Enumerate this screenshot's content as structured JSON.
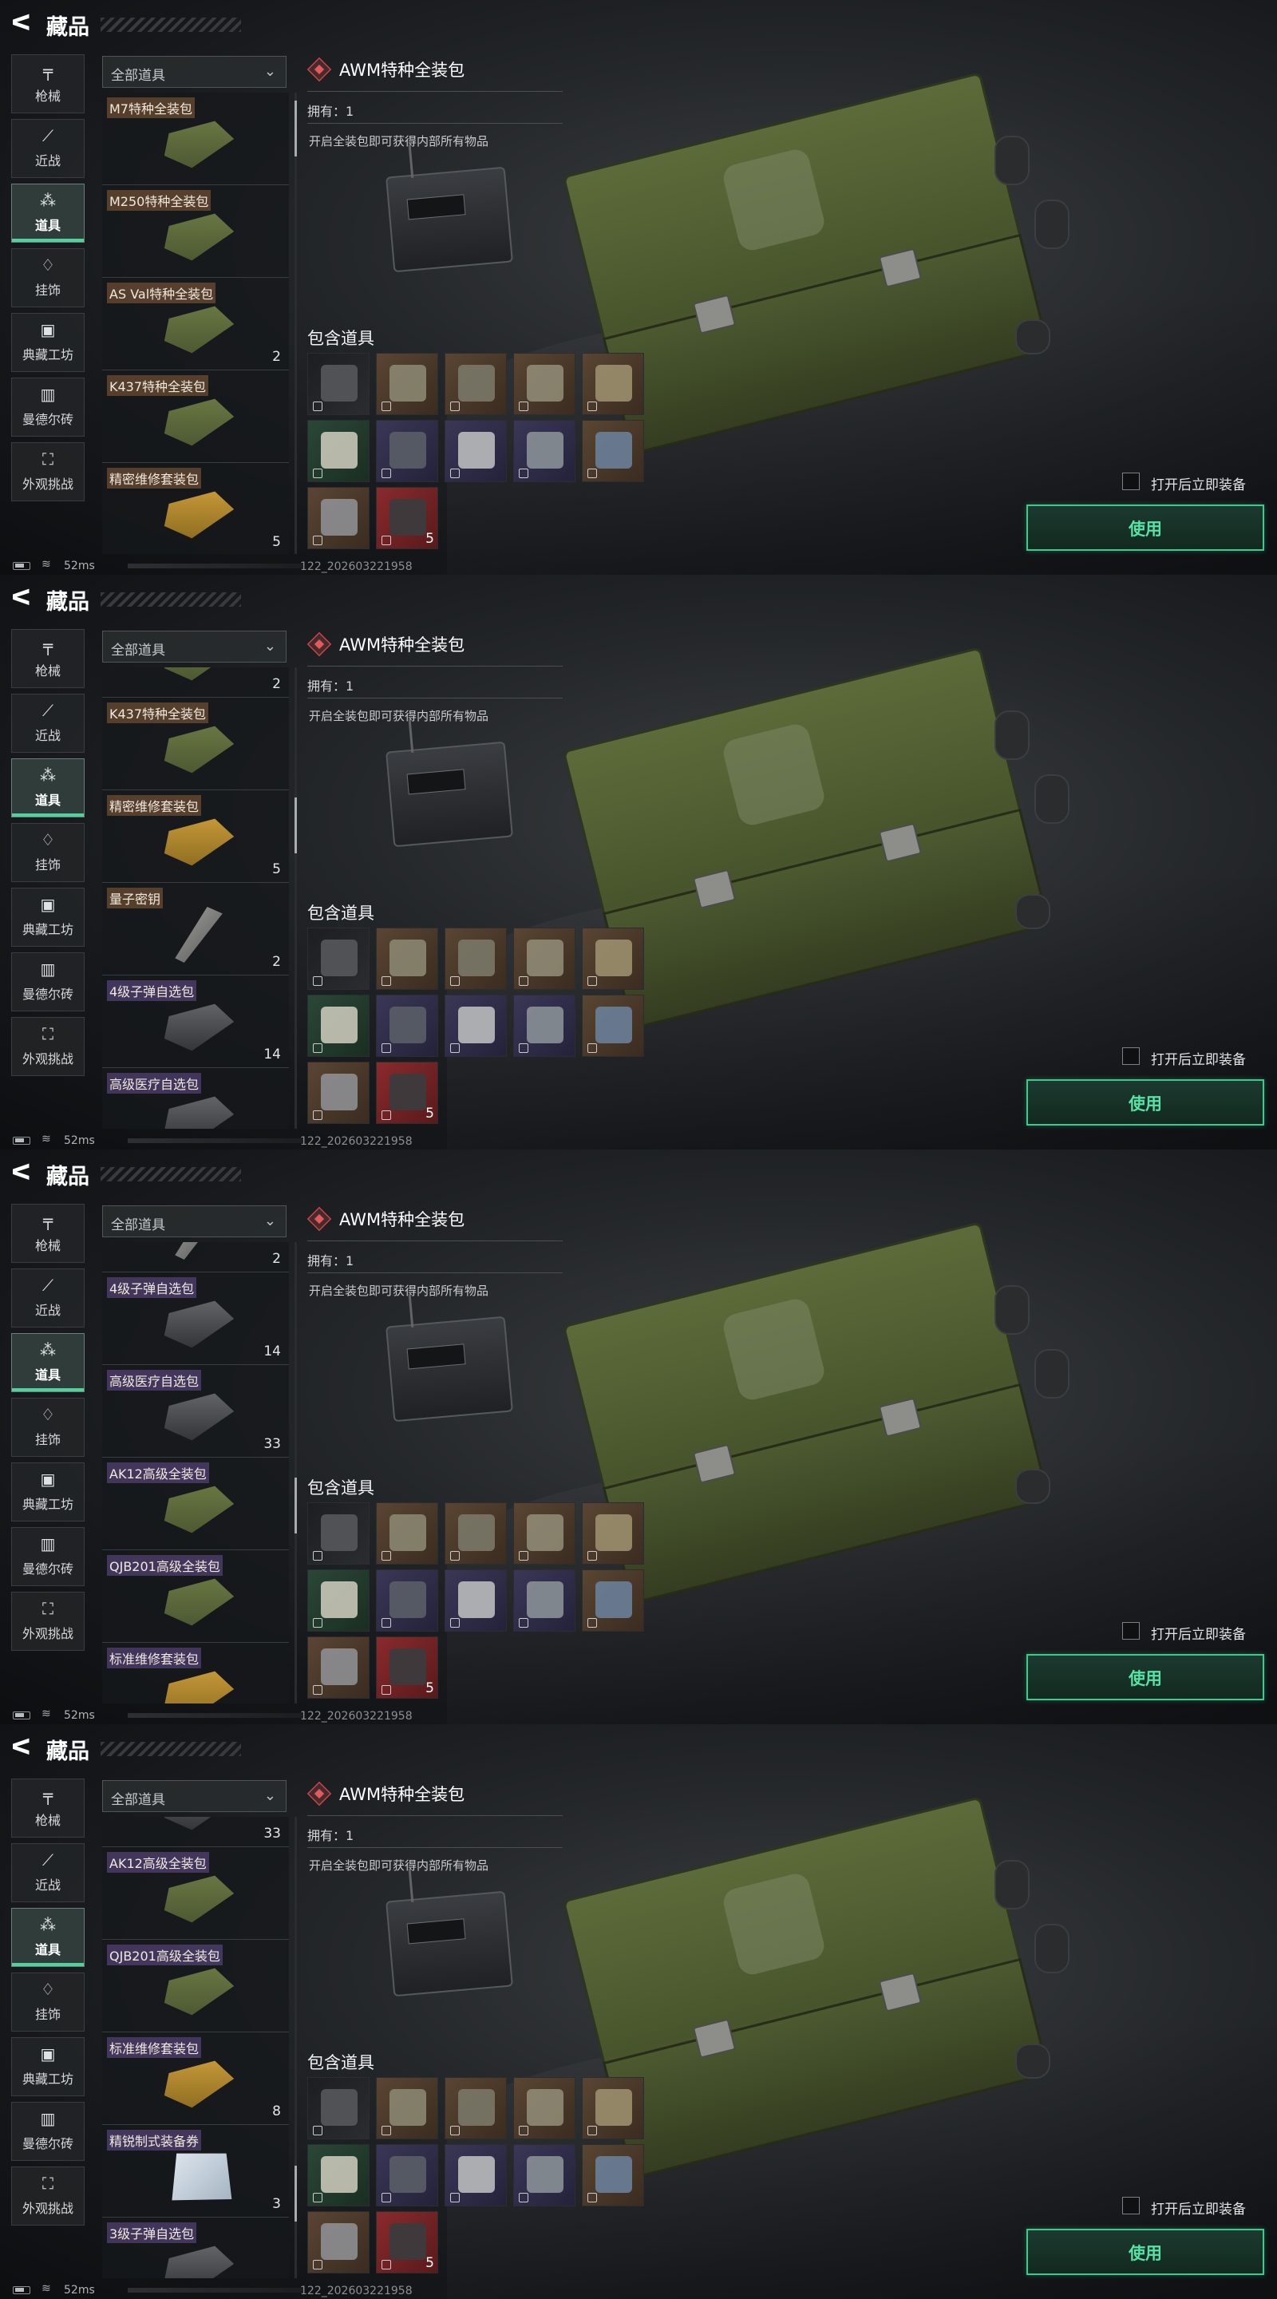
{
  "header": {
    "back_glyph": "ᐸ",
    "title": "藏品"
  },
  "categories": [
    {
      "icon": "pistol-icon",
      "glyph": "╤",
      "label": "枪械"
    },
    {
      "icon": "knife-icon",
      "glyph": "⟋",
      "label": "近战"
    },
    {
      "icon": "items-icon",
      "glyph": "⁂",
      "label": "道具",
      "active": true
    },
    {
      "icon": "charm-icon",
      "glyph": "♢",
      "label": "挂饰"
    },
    {
      "icon": "workshop-icon",
      "glyph": "▣",
      "label": "典藏工坊"
    },
    {
      "icon": "brick-icon",
      "glyph": "▥",
      "label": "曼德尔砖"
    },
    {
      "icon": "appearance-icon",
      "glyph": "⛶",
      "label": "外观挑战"
    }
  ],
  "filter": {
    "value": "全部道具",
    "chevron": "⌄"
  },
  "detail": {
    "title": "AWM特种全装包",
    "owned": "拥有：1",
    "description": "开启全装包即可获得内部所有物品",
    "included_label": "包含道具",
    "slots": [
      {
        "bg": "black",
        "color": "#55585b",
        "qty": ""
      },
      {
        "bg": "brown",
        "color": "#8a8670",
        "qty": ""
      },
      {
        "bg": "brown",
        "color": "#7a7868",
        "qty": ""
      },
      {
        "bg": "brown",
        "color": "#8f8a74",
        "qty": ""
      },
      {
        "bg": "brown",
        "color": "#9a8f6e",
        "qty": ""
      },
      {
        "bg": "green",
        "color": "#c8c6b8",
        "qty": ""
      },
      {
        "bg": "purple",
        "color": "#5a5e66",
        "qty": ""
      },
      {
        "bg": "purple",
        "color": "#b9bbbd",
        "qty": ""
      },
      {
        "bg": "purple",
        "color": "#8a9096",
        "qty": ""
      },
      {
        "bg": "brown",
        "color": "#6a7f99",
        "qty": ""
      },
      {
        "bg": "brown",
        "color": "#8d8f92",
        "qty": ""
      },
      {
        "bg": "red",
        "color": "#3a3c3f",
        "qty": "5"
      }
    ]
  },
  "auto_equip_label": "打开后立即装备",
  "use_button": "使用",
  "status": {
    "wifi_glyph": "≋",
    "ping": "52ms",
    "build": "122_202603221958"
  },
  "panels": [
    {
      "scroll": 0.02,
      "items": [
        {
          "name": "M7特种全装包",
          "type": "green",
          "tag": "o",
          "qty": ""
        },
        {
          "name": "M250特种全装包",
          "type": "green",
          "tag": "o",
          "qty": ""
        },
        {
          "name": "AS Val特种全装包",
          "type": "green",
          "tag": "o",
          "qty": "2"
        },
        {
          "name": "K437特种全装包",
          "type": "green",
          "tag": "o",
          "qty": ""
        },
        {
          "name": "精密维修套装包",
          "type": "yellow",
          "tag": "o",
          "qty": "5"
        }
      ]
    },
    {
      "scroll": 0.32,
      "items": [
        {
          "name": "",
          "type": "green",
          "tag": "o",
          "qty": "2"
        },
        {
          "name": "K437特种全装包",
          "type": "green",
          "tag": "o",
          "qty": ""
        },
        {
          "name": "精密维修套装包",
          "type": "yellow",
          "tag": "o",
          "qty": "5"
        },
        {
          "name": "量子密钥",
          "type": "key",
          "tag": "o",
          "qty": "2"
        },
        {
          "name": "4级子弹自选包",
          "type": "grey",
          "tag": "p",
          "qty": "14"
        },
        {
          "name": "高级医疗自选包",
          "type": "grey",
          "tag": "p",
          "qty": ""
        }
      ]
    },
    {
      "scroll": 0.58,
      "items": [
        {
          "name": "",
          "type": "key",
          "tag": "o",
          "qty": "2"
        },
        {
          "name": "4级子弹自选包",
          "type": "grey",
          "tag": "p",
          "qty": "14"
        },
        {
          "name": "高级医疗自选包",
          "type": "grey",
          "tag": "p",
          "qty": "33"
        },
        {
          "name": "AK12高级全装包",
          "type": "green",
          "tag": "p",
          "qty": ""
        },
        {
          "name": "QJB201高级全装包",
          "type": "green",
          "tag": "p",
          "qty": ""
        },
        {
          "name": "标准维修套装包",
          "type": "yellow",
          "tag": "p",
          "qty": ""
        }
      ]
    },
    {
      "scroll": 0.86,
      "items": [
        {
          "name": "",
          "type": "grey",
          "tag": "p",
          "qty": "33"
        },
        {
          "name": "AK12高级全装包",
          "type": "green",
          "tag": "p",
          "qty": ""
        },
        {
          "name": "QJB201高级全装包",
          "type": "green",
          "tag": "p",
          "qty": ""
        },
        {
          "name": "标准维修套装包",
          "type": "yellow",
          "tag": "p",
          "qty": "8"
        },
        {
          "name": "精锐制式装备券",
          "type": "bag",
          "tag": "p",
          "qty": "3"
        },
        {
          "name": "3级子弹自选包",
          "type": "grey",
          "tag": "p",
          "qty": ""
        }
      ]
    }
  ]
}
